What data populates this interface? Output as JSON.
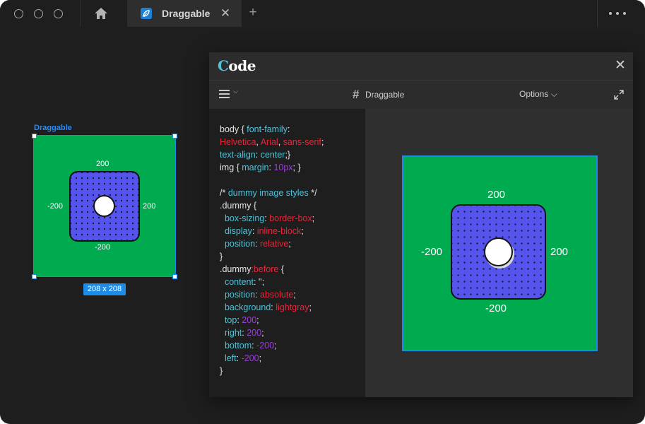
{
  "app": {
    "tab_title": "Draggable",
    "tab_close": "✕",
    "tab_add": "+"
  },
  "canvas": {
    "selection_label": "Draggable",
    "size_badge": "208 x 208",
    "labels": {
      "top": "200",
      "right": "200",
      "bottom": "-200",
      "left": "-200"
    }
  },
  "panel": {
    "title_first": "C",
    "title_rest": "ode",
    "close": "✕",
    "project_name": "Draggable",
    "options_label": "Options ⌵",
    "code_lines": [
      "body { font-family:",
      "Helvetica, Arial, sans-serif;",
      "text-align: center;}",
      "img { margin: 10px; }",
      "",
      "/* dummy image styles */",
      ".dummy {",
      "  box-sizing: border-box;",
      "  display: inline-block;",
      "  position: relative;",
      "}",
      ".dummy:before {",
      "  content: '';",
      "  position: absolute;",
      "  background: lightgray;",
      "  top: 200;",
      "  right: 200;",
      "  bottom: -200;",
      "  left: -200;",
      "}"
    ],
    "preview_labels": {
      "top": "200",
      "right": "200",
      "bottom": "-200",
      "left": "-200"
    }
  },
  "colors": {
    "stage_green": "#00ab4f",
    "dummy_blue": "#5555ee",
    "selection_blue": "#1e8ce6",
    "accent_cyan": "#4fc3d9"
  },
  "icons": [
    "home-icon",
    "app-logo-icon",
    "close-icon",
    "plus-icon",
    "more-icon",
    "hamburger-icon",
    "hash-icon",
    "expand-icon"
  ]
}
